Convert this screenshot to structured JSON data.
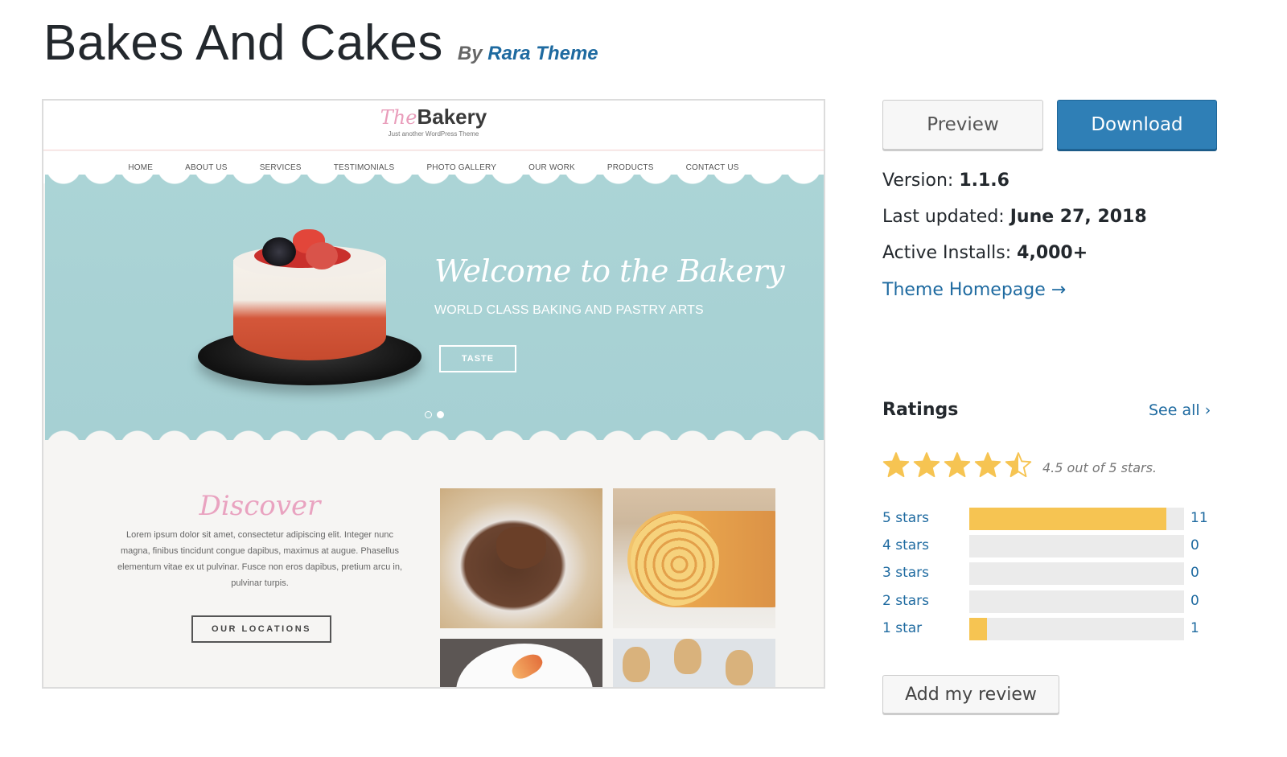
{
  "header": {
    "title": "Bakes And Cakes",
    "by_label": "By",
    "author": "Rara Theme"
  },
  "preview_site": {
    "logo_the": "The",
    "logo_bakery": "Bakery",
    "tagline": "Just another WordPress Theme",
    "nav": [
      "HOME",
      "ABOUT US",
      "SERVICES",
      "TESTIMONIALS",
      "PHOTO GALLERY",
      "OUR WORK",
      "PRODUCTS",
      "CONTACT US"
    ],
    "hero": {
      "title": "Welcome to the Bakery",
      "subtitle": "WORLD CLASS BAKING AND PASTRY ARTS",
      "button": "TASTE",
      "slides": 2,
      "active_slide": 2
    },
    "discover": {
      "title": "Discover",
      "text": "Lorem ipsum dolor sit amet, consectetur adipiscing elit. Integer nunc magna, finibus tincidunt congue dapibus, maximus at augue. Phasellus elementum vitae ex ut pulvinar. Fusce non eros dapibus, pretium arcu in, pulvinar turpis.",
      "button": "OUR LOCATIONS"
    },
    "gallery": [
      "chocolate-heart-cookie",
      "swiss-roll",
      "peach-slices-plate",
      "bunny-cookies"
    ]
  },
  "actions": {
    "preview": "Preview",
    "download": "Download"
  },
  "meta": {
    "version_label": "Version:",
    "version": "1.1.6",
    "updated_label": "Last updated:",
    "updated": "June 27, 2018",
    "installs_label": "Active Installs:",
    "installs": "4,000+",
    "homepage_link": "Theme Homepage →"
  },
  "ratings": {
    "title": "Ratings",
    "see_all": "See all",
    "average": 4.5,
    "max": 5,
    "summary": "4.5 out of 5 stars.",
    "star_color": "#f6c452",
    "rows": [
      {
        "label": "5 stars",
        "count": 11,
        "fraction": 0.917
      },
      {
        "label": "4 stars",
        "count": 0,
        "fraction": 0
      },
      {
        "label": "3 stars",
        "count": 0,
        "fraction": 0
      },
      {
        "label": "2 stars",
        "count": 0,
        "fraction": 0
      },
      {
        "label": "1 star",
        "count": 1,
        "fraction": 0.083
      }
    ],
    "add_review": "Add my review"
  },
  "colors": {
    "link": "#1e6aa0",
    "primary_button": "#2f7fb6",
    "rating_bar": "#f6c452",
    "rating_track": "#ebebeb"
  }
}
